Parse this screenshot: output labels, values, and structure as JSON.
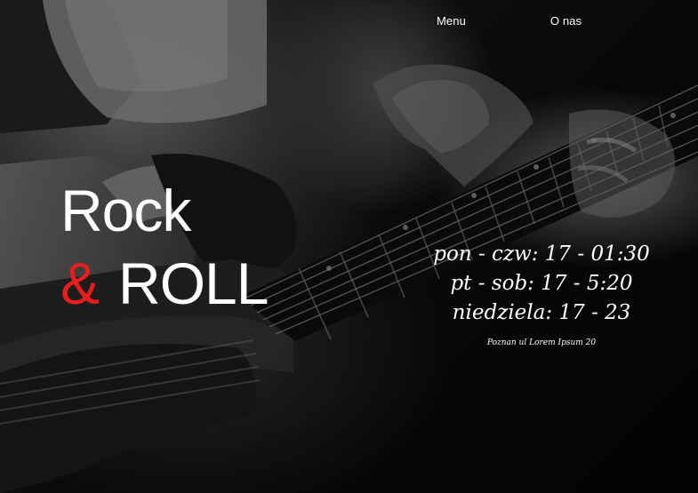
{
  "nav": {
    "items": [
      {
        "label": "Menu"
      },
      {
        "label": "O nas"
      }
    ]
  },
  "hero": {
    "title_line1": "Rock",
    "title_amp": "&",
    "title_line2": "ROLL",
    "amp_color": "#ea1d1d"
  },
  "hours": {
    "rows": [
      {
        "text": "pon - czw: 17 - 01:30"
      },
      {
        "text": "pt - sob: 17 - 5:20"
      },
      {
        "text": "niedziela: 17 - 23"
      }
    ],
    "address": "Poznan ul Lorem Ipsum 20"
  },
  "background": {
    "subject": "black-and-white guitarist playing an electric guitar"
  }
}
